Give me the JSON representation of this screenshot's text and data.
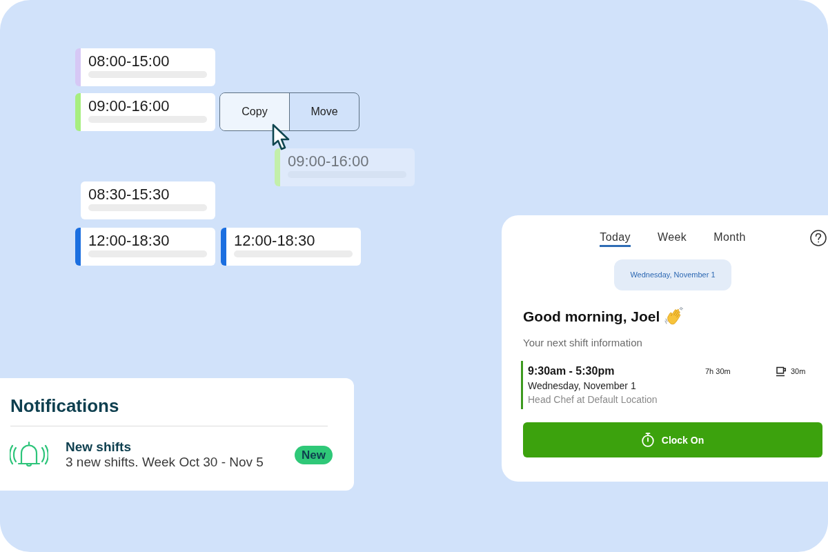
{
  "shift_board": {
    "shifts": [
      {
        "time": "08:00-15:00",
        "color": "#d6c8f5"
      },
      {
        "time": "09:00-16:00",
        "color": "#a7ee80"
      },
      {
        "time": "08:30-15:30"
      },
      {
        "time": "12:00-18:30",
        "color": "#1b6fe0"
      },
      {
        "time": "12:00-18:30",
        "color": "#1b6fe0"
      }
    ],
    "shift_menu": [
      {
        "label": "Copy",
        "selected": true
      },
      {
        "label": "Move",
        "selected": false
      }
    ],
    "drag_preview": {
      "time": "09:00-16:00",
      "color": "#c3efaa"
    }
  },
  "notifications": {
    "title": "Notifications",
    "items": [
      {
        "title": "New shifts",
        "description": "3 new shifts. Week Oct 30 - Nov 5",
        "badge": "New"
      }
    ]
  },
  "today_panel": {
    "tabs": [
      {
        "label": "Today",
        "selected": true
      },
      {
        "label": "Week",
        "selected": false
      },
      {
        "label": "Month",
        "selected": false
      }
    ],
    "date": "Wednesday, November 1",
    "greeting": "Good morning, Joel",
    "subtitle": "Your next shift information",
    "next_shift": {
      "time": "9:30am - 5:30pm",
      "duration": "7h 30m",
      "break": "30m",
      "date": "Wednesday, November 1",
      "role": "Head Chef at Default Location"
    },
    "clock_button": "Clock On"
  }
}
